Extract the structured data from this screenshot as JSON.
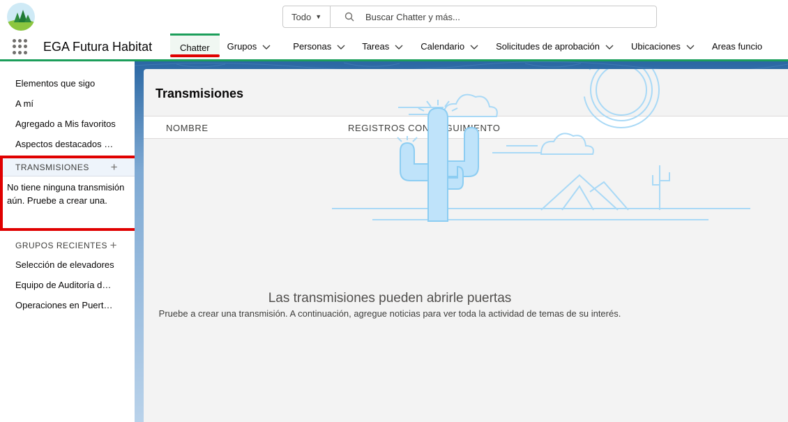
{
  "header": {
    "search_scope": "Todo",
    "search_placeholder": "Buscar Chatter y más..."
  },
  "navbar": {
    "app_name": "EGA Futura Habitat",
    "items": [
      {
        "label": "Chatter",
        "active": true
      },
      {
        "label": "Grupos"
      },
      {
        "label": "Personas"
      },
      {
        "label": "Tareas"
      },
      {
        "label": "Calendario"
      },
      {
        "label": "Solicitudes de aprobación"
      },
      {
        "label": "Ubicaciones"
      },
      {
        "label": "Areas funcio"
      }
    ]
  },
  "sidebar": {
    "links": [
      "Elementos que sigo",
      "A mí",
      "Agregado a Mis favoritos",
      "Aspectos destacados de la compañía"
    ],
    "streams_header": "TRANSMISIONES",
    "streams_empty": "No tiene ninguna transmisión aún. Pruebe a crear una.",
    "recent_groups_header": "GRUPOS RECIENTES",
    "recent_groups": [
      "Selección de elevadores",
      "Equipo de Auditoría de Calidad",
      "Operaciones en Puerto Rico"
    ]
  },
  "main": {
    "title": "Transmisiones",
    "columns": [
      "NOMBRE",
      "REGISTROS CON SEGUIMIENTO"
    ],
    "empty_title": "Las transmisiones pueden abrirle puertas",
    "empty_subtitle": "Pruebe a crear una transmisión. A continuación, agregue noticias para ver toda la actividad de temas de su interés."
  },
  "colors": {
    "brand_green": "#1b9e5a",
    "highlight_red": "#e00000",
    "header_blue": "#2c6ba8",
    "illustration_blue": "#a9d9f6"
  }
}
